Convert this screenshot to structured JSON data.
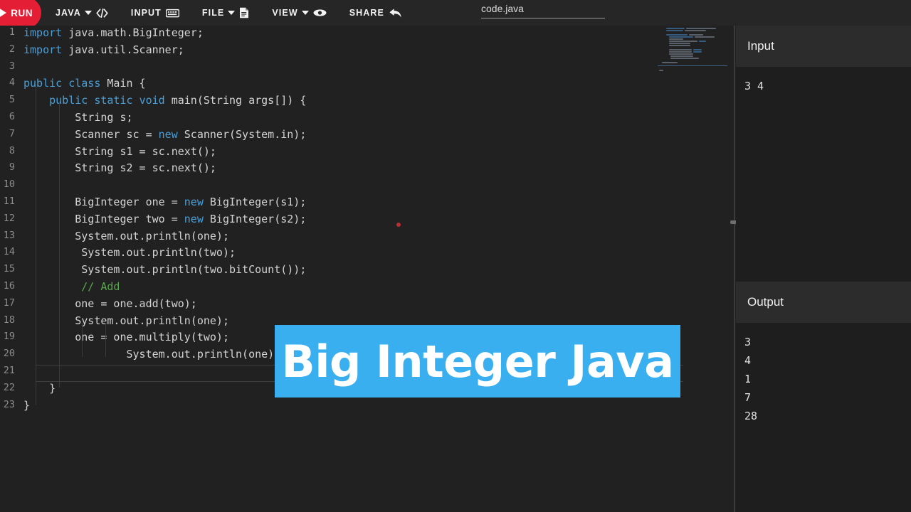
{
  "toolbar": {
    "run_label": "RUN",
    "run_color": "#e41f35",
    "menu": [
      {
        "label": "JAVA",
        "icon": "code-icon",
        "has_caret": true
      },
      {
        "label": "INPUT",
        "icon": "keyboard-icon",
        "has_caret": false
      },
      {
        "label": "FILE",
        "icon": "document-icon",
        "has_caret": true
      },
      {
        "label": "VIEW",
        "icon": "eye-icon",
        "has_caret": true
      },
      {
        "label": "SHARE",
        "icon": "share-arrow-icon",
        "has_caret": false
      }
    ],
    "filename": "code.java"
  },
  "editor": {
    "language": "java",
    "line_numbers": [
      "1",
      "2",
      "3",
      "4",
      "5",
      "6",
      "7",
      "8",
      "9",
      "10",
      "11",
      "12",
      "13",
      "14",
      "15",
      "16",
      "17",
      "18",
      "19",
      "20",
      "21",
      "22",
      "23"
    ],
    "lines": [
      {
        "n": "1",
        "indent": 0,
        "text": "import java.math.BigInteger;"
      },
      {
        "n": "2",
        "indent": 0,
        "text": "import java.util.Scanner;"
      },
      {
        "n": "3",
        "indent": 0,
        "text": ""
      },
      {
        "n": "4",
        "indent": 0,
        "text": "public class Main {"
      },
      {
        "n": "5",
        "indent": 0,
        "text": "    public static void main(String args[]) {"
      },
      {
        "n": "6",
        "indent": 0,
        "text": "        String s;"
      },
      {
        "n": "7",
        "indent": 0,
        "text": "        Scanner sc = new Scanner(System.in);"
      },
      {
        "n": "8",
        "indent": 0,
        "text": "        String s1 = sc.next();"
      },
      {
        "n": "9",
        "indent": 0,
        "text": "        String s2 = sc.next();"
      },
      {
        "n": "10",
        "indent": 0,
        "text": ""
      },
      {
        "n": "11",
        "indent": 0,
        "text": "        BigInteger one = new BigInteger(s1);"
      },
      {
        "n": "12",
        "indent": 0,
        "text": "        BigInteger two = new BigInteger(s2);"
      },
      {
        "n": "13",
        "indent": 0,
        "text": "        System.out.println(one);"
      },
      {
        "n": "14",
        "indent": 0,
        "text": "         System.out.println(two);"
      },
      {
        "n": "15",
        "indent": 0,
        "text": "         System.out.println(two.bitCount());"
      },
      {
        "n": "16",
        "indent": 0,
        "text": "         // Add"
      },
      {
        "n": "17",
        "indent": 0,
        "text": "        one = one.add(two);"
      },
      {
        "n": "18",
        "indent": 0,
        "text": "        System.out.println(one);"
      },
      {
        "n": "19",
        "indent": 0,
        "text": "        one = one.multiply(two);"
      },
      {
        "n": "20",
        "indent": 0,
        "text": "                System.out.println(one);"
      },
      {
        "n": "21",
        "indent": 0,
        "text": ""
      },
      {
        "n": "22",
        "indent": 0,
        "text": "    }"
      },
      {
        "n": "23",
        "indent": 0,
        "text": "}"
      }
    ],
    "keywords": [
      "import",
      "public",
      "class",
      "static",
      "void",
      "new"
    ],
    "comment_text": "// Add",
    "colors": {
      "background": "#212121",
      "text": "#d4d4d4",
      "keyword": "#4a9fd8",
      "comment": "#57a64a",
      "line_number": "#8c8c8c"
    },
    "cursor_line": "21"
  },
  "panels": {
    "input": {
      "title": "Input",
      "value": "3 4"
    },
    "output": {
      "title": "Output",
      "lines": [
        "3",
        "4",
        "1",
        "7",
        "28"
      ]
    }
  },
  "banner": {
    "text": "Big Integer Java",
    "background": "#3aaff0",
    "text_color": "#ffffff"
  }
}
